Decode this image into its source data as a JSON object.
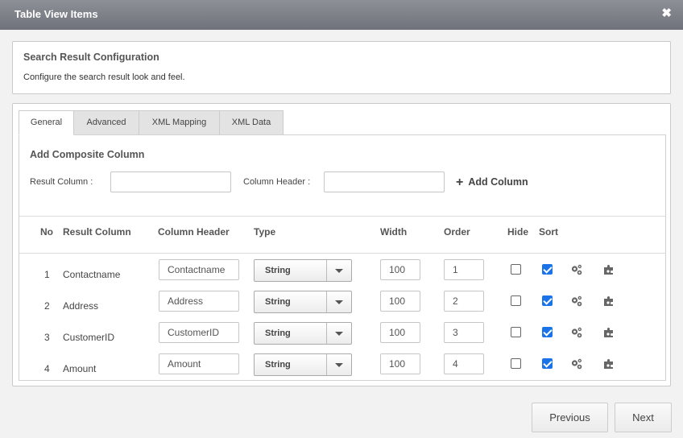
{
  "window": {
    "title": "Table View Items",
    "close_glyph": "✖"
  },
  "config": {
    "heading": "Search Result Configuration",
    "description": "Configure the search result look and feel."
  },
  "tabs": [
    {
      "label": "General",
      "active": true
    },
    {
      "label": "Advanced",
      "active": false
    },
    {
      "label": "XML Mapping",
      "active": false
    },
    {
      "label": "XML Data",
      "active": false
    }
  ],
  "composite": {
    "heading": "Add Composite Column",
    "result_column_label": "Result Column :",
    "result_column_value": "",
    "column_header_label": "Column Header :",
    "column_header_value": "",
    "add_button": "Add Column"
  },
  "table": {
    "headers": [
      "No",
      "Result Column",
      "Column Header",
      "Type",
      "Width",
      "Order",
      "Hide",
      "Sort"
    ],
    "rows": [
      {
        "no": "1",
        "result_column": "Contactname",
        "column_header": "Contactname",
        "type": "String",
        "width": "100",
        "order": "1",
        "hide": false,
        "sort": true
      },
      {
        "no": "2",
        "result_column": "Address",
        "column_header": "Address",
        "type": "String",
        "width": "100",
        "order": "2",
        "hide": false,
        "sort": true
      },
      {
        "no": "3",
        "result_column": "CustomerID",
        "column_header": "CustomerID",
        "type": "String",
        "width": "100",
        "order": "3",
        "hide": false,
        "sort": true
      },
      {
        "no": "4",
        "result_column": "Amount",
        "column_header": "Amount",
        "type": "String",
        "width": "100",
        "order": "4",
        "hide": false,
        "sort": true
      }
    ],
    "row_icons": [
      "gears-icon",
      "puzzle-settings-icon"
    ]
  },
  "footer": {
    "previous": "Previous",
    "next": "Next"
  },
  "colors": {
    "titlebar": "#7d8088",
    "checkbox_checked": "#1a73e8",
    "icon": "#666666"
  }
}
